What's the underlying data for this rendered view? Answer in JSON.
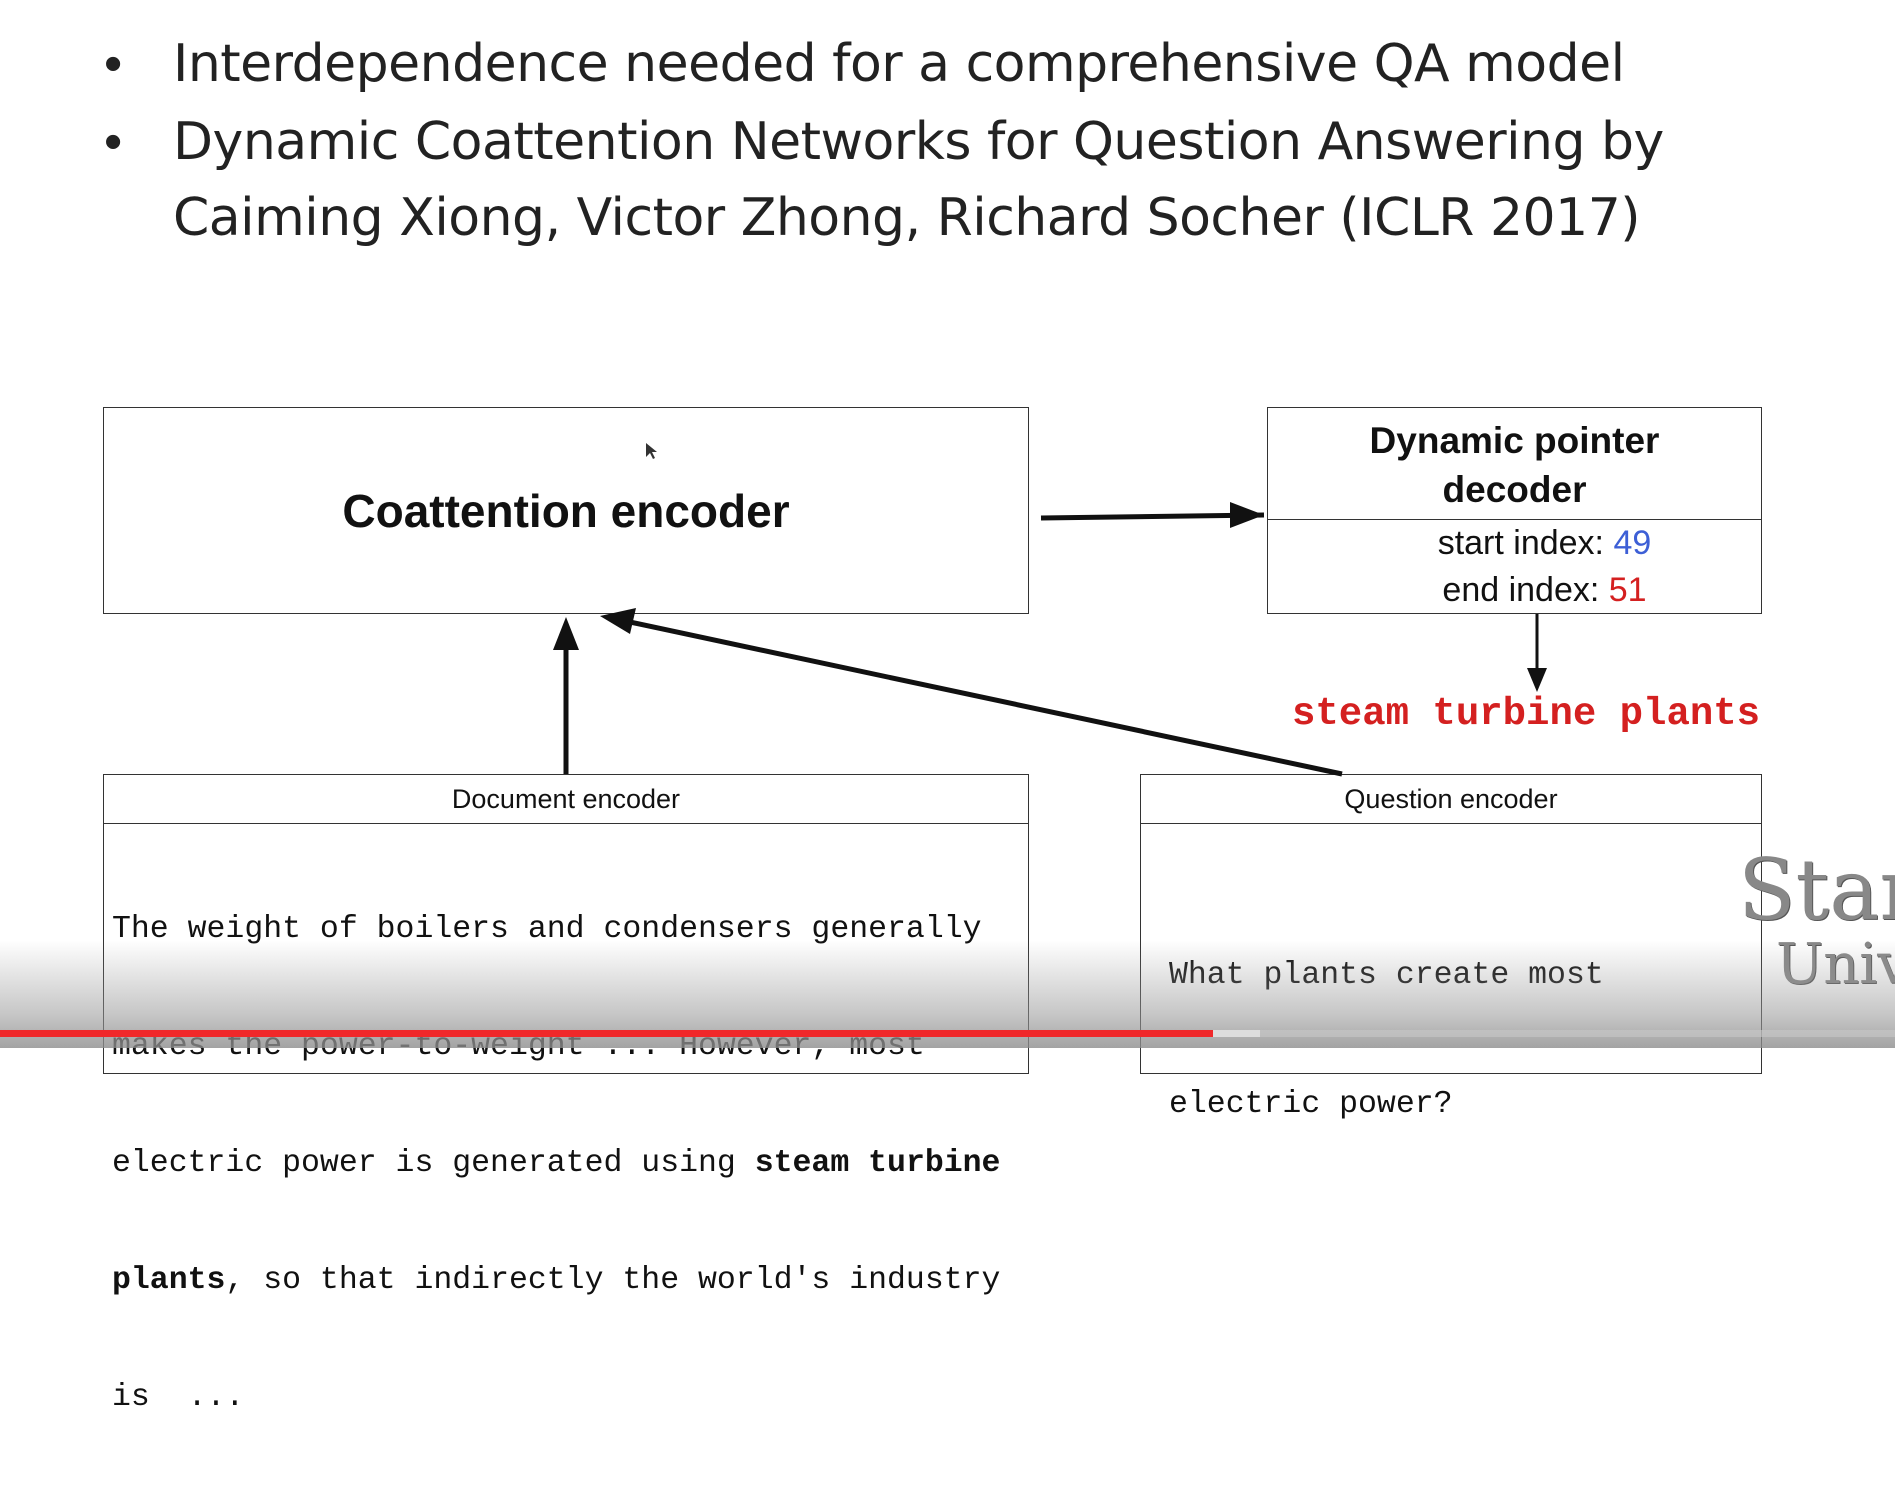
{
  "slide": {
    "bullets": [
      {
        "marker": "•",
        "lines": [
          "Interdependence needed for a comprehensive QA model"
        ]
      },
      {
        "marker": "•",
        "lines": [
          "Dynamic Coattention Networks for Question Answering by",
          "Caiming Xiong, Victor Zhong, Richard Socher (ICLR 2017)"
        ]
      }
    ],
    "diagram": {
      "coattention_encoder": "Coattention encoder",
      "decoder": {
        "title_lines": [
          "Dynamic pointer",
          "decoder"
        ],
        "start_label": "start index: ",
        "start_value": "49",
        "end_label": "end index: ",
        "end_value": "51"
      },
      "answer": "steam turbine plants",
      "document_encoder": {
        "title": "Document encoder",
        "lines": [
          "The weight of boilers and condensers generally",
          "makes the power-to-weight ... However, most",
          "electric power is generated using ",
          ", so that indirectly the world's industry",
          "is  ..."
        ],
        "bold_1": "steam turbine",
        "bold_2": "plants"
      },
      "question_encoder": {
        "title": "Question encoder",
        "lines": [
          "What plants create most",
          "electric power?"
        ]
      }
    },
    "logo": {
      "line1": "Stan",
      "line2": "Univ"
    }
  },
  "video": {
    "progress_percent": 64,
    "buffered_percent": 66.5
  },
  "colors": {
    "start": "#3d5fd6",
    "end": "#d42020",
    "answer": "#d42020",
    "progress": "#f0282a"
  }
}
